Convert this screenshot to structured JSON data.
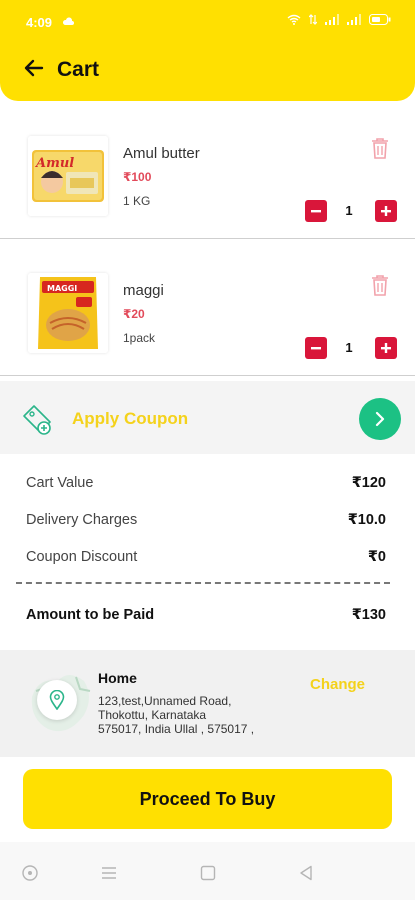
{
  "status_bar": {
    "time": "4:09"
  },
  "header": {
    "title": "Cart"
  },
  "items": [
    {
      "name": "Amul butter",
      "price": "₹100",
      "unit": "1 KG",
      "quantity": "1",
      "image_icon": "amul-butter-image"
    },
    {
      "name": "maggi",
      "price": "₹20",
      "unit": "1pack",
      "quantity": "1",
      "image_icon": "maggi-image"
    }
  ],
  "coupon": {
    "label": "Apply Coupon"
  },
  "summary": {
    "cart_value_label": "Cart Value",
    "cart_value": "₹120",
    "delivery_label": "Delivery Charges",
    "delivery": "₹10.0",
    "discount_label": "Coupon Discount",
    "discount": "₹0",
    "total_label": "Amount to be Paid",
    "total": "₹130"
  },
  "address": {
    "title": "Home",
    "line1": "123,test,Unnamed Road,",
    "line2": "Thokottu, Karnataka",
    "line3": "575017, India Ullal , 575017 ,",
    "change_label": "Change"
  },
  "cta": {
    "label": "Proceed To Buy"
  },
  "colors": {
    "brand_yellow": "#FFE001",
    "price_red": "#e24a5a",
    "qty_red": "#d9163a",
    "coupon_green": "#1cc184",
    "coupon_text": "#f4d21c"
  }
}
